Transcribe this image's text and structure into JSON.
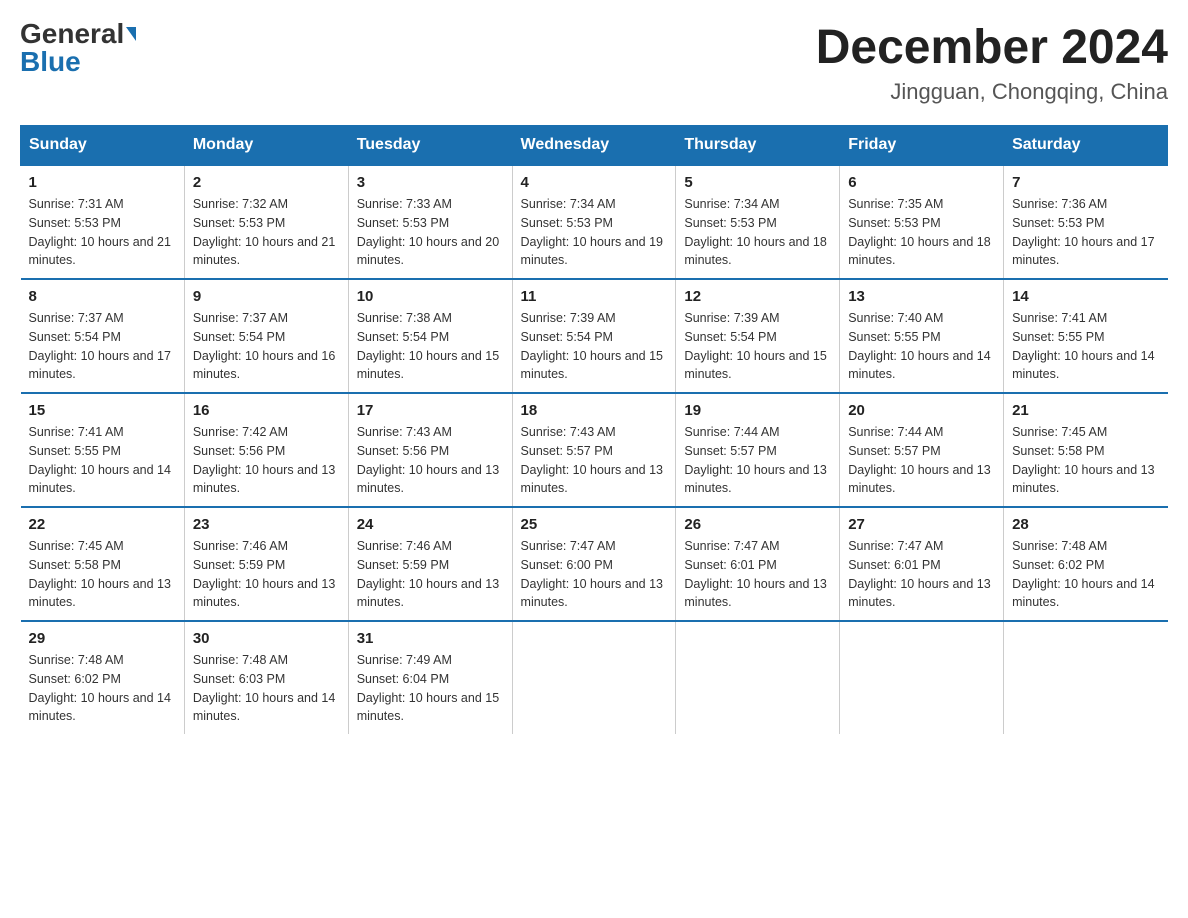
{
  "header": {
    "logo_general": "General",
    "logo_blue": "Blue",
    "month_title": "December 2024",
    "location": "Jingguan, Chongqing, China"
  },
  "days_of_week": [
    "Sunday",
    "Monday",
    "Tuesday",
    "Wednesday",
    "Thursday",
    "Friday",
    "Saturday"
  ],
  "weeks": [
    [
      {
        "day": "1",
        "sunrise": "7:31 AM",
        "sunset": "5:53 PM",
        "daylight": "10 hours and 21 minutes."
      },
      {
        "day": "2",
        "sunrise": "7:32 AM",
        "sunset": "5:53 PM",
        "daylight": "10 hours and 21 minutes."
      },
      {
        "day": "3",
        "sunrise": "7:33 AM",
        "sunset": "5:53 PM",
        "daylight": "10 hours and 20 minutes."
      },
      {
        "day": "4",
        "sunrise": "7:34 AM",
        "sunset": "5:53 PM",
        "daylight": "10 hours and 19 minutes."
      },
      {
        "day": "5",
        "sunrise": "7:34 AM",
        "sunset": "5:53 PM",
        "daylight": "10 hours and 18 minutes."
      },
      {
        "day": "6",
        "sunrise": "7:35 AM",
        "sunset": "5:53 PM",
        "daylight": "10 hours and 18 minutes."
      },
      {
        "day": "7",
        "sunrise": "7:36 AM",
        "sunset": "5:53 PM",
        "daylight": "10 hours and 17 minutes."
      }
    ],
    [
      {
        "day": "8",
        "sunrise": "7:37 AM",
        "sunset": "5:54 PM",
        "daylight": "10 hours and 17 minutes."
      },
      {
        "day": "9",
        "sunrise": "7:37 AM",
        "sunset": "5:54 PM",
        "daylight": "10 hours and 16 minutes."
      },
      {
        "day": "10",
        "sunrise": "7:38 AM",
        "sunset": "5:54 PM",
        "daylight": "10 hours and 15 minutes."
      },
      {
        "day": "11",
        "sunrise": "7:39 AM",
        "sunset": "5:54 PM",
        "daylight": "10 hours and 15 minutes."
      },
      {
        "day": "12",
        "sunrise": "7:39 AM",
        "sunset": "5:54 PM",
        "daylight": "10 hours and 15 minutes."
      },
      {
        "day": "13",
        "sunrise": "7:40 AM",
        "sunset": "5:55 PM",
        "daylight": "10 hours and 14 minutes."
      },
      {
        "day": "14",
        "sunrise": "7:41 AM",
        "sunset": "5:55 PM",
        "daylight": "10 hours and 14 minutes."
      }
    ],
    [
      {
        "day": "15",
        "sunrise": "7:41 AM",
        "sunset": "5:55 PM",
        "daylight": "10 hours and 14 minutes."
      },
      {
        "day": "16",
        "sunrise": "7:42 AM",
        "sunset": "5:56 PM",
        "daylight": "10 hours and 13 minutes."
      },
      {
        "day": "17",
        "sunrise": "7:43 AM",
        "sunset": "5:56 PM",
        "daylight": "10 hours and 13 minutes."
      },
      {
        "day": "18",
        "sunrise": "7:43 AM",
        "sunset": "5:57 PM",
        "daylight": "10 hours and 13 minutes."
      },
      {
        "day": "19",
        "sunrise": "7:44 AM",
        "sunset": "5:57 PM",
        "daylight": "10 hours and 13 minutes."
      },
      {
        "day": "20",
        "sunrise": "7:44 AM",
        "sunset": "5:57 PM",
        "daylight": "10 hours and 13 minutes."
      },
      {
        "day": "21",
        "sunrise": "7:45 AM",
        "sunset": "5:58 PM",
        "daylight": "10 hours and 13 minutes."
      }
    ],
    [
      {
        "day": "22",
        "sunrise": "7:45 AM",
        "sunset": "5:58 PM",
        "daylight": "10 hours and 13 minutes."
      },
      {
        "day": "23",
        "sunrise": "7:46 AM",
        "sunset": "5:59 PM",
        "daylight": "10 hours and 13 minutes."
      },
      {
        "day": "24",
        "sunrise": "7:46 AM",
        "sunset": "5:59 PM",
        "daylight": "10 hours and 13 minutes."
      },
      {
        "day": "25",
        "sunrise": "7:47 AM",
        "sunset": "6:00 PM",
        "daylight": "10 hours and 13 minutes."
      },
      {
        "day": "26",
        "sunrise": "7:47 AM",
        "sunset": "6:01 PM",
        "daylight": "10 hours and 13 minutes."
      },
      {
        "day": "27",
        "sunrise": "7:47 AM",
        "sunset": "6:01 PM",
        "daylight": "10 hours and 13 minutes."
      },
      {
        "day": "28",
        "sunrise": "7:48 AM",
        "sunset": "6:02 PM",
        "daylight": "10 hours and 14 minutes."
      }
    ],
    [
      {
        "day": "29",
        "sunrise": "7:48 AM",
        "sunset": "6:02 PM",
        "daylight": "10 hours and 14 minutes."
      },
      {
        "day": "30",
        "sunrise": "7:48 AM",
        "sunset": "6:03 PM",
        "daylight": "10 hours and 14 minutes."
      },
      {
        "day": "31",
        "sunrise": "7:49 AM",
        "sunset": "6:04 PM",
        "daylight": "10 hours and 15 minutes."
      },
      null,
      null,
      null,
      null
    ]
  ]
}
